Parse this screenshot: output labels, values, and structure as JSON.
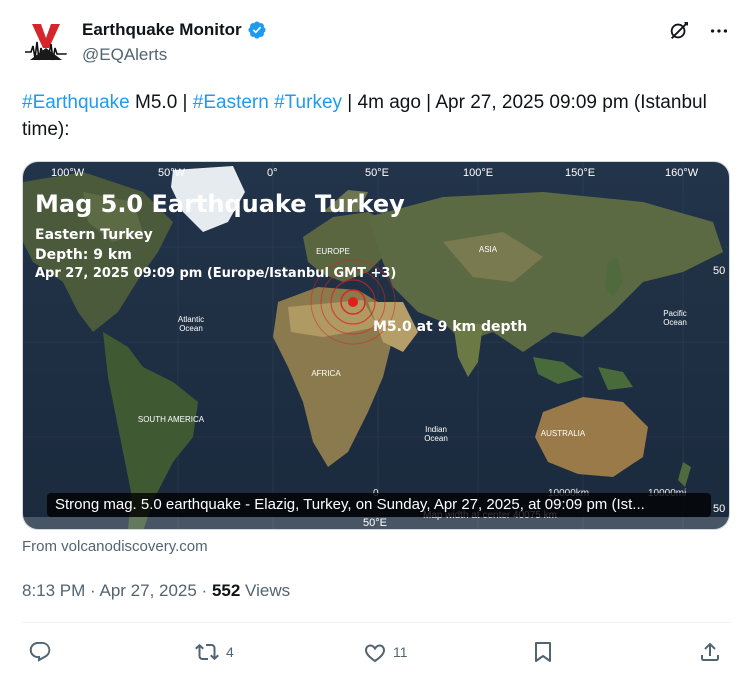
{
  "author": {
    "display_name": "Earthquake Monitor",
    "handle": "@EQAlerts",
    "verified": true,
    "avatar_icon": "earthquake-seismograph-logo-icon"
  },
  "tweet": {
    "tag1": "#Earthquake",
    "text1": " M5.0 | ",
    "tag2": "#Eastern",
    "text2": " ",
    "tag3": "#Turkey",
    "text3": " | 4m ago | Apr 27, 2025 09:09 pm (Istanbul time):"
  },
  "media": {
    "title": "Mag 5.0 Earthquake Turkey",
    "region": "Eastern Turkey",
    "depth": "Depth: 9 km",
    "datetime": "Apr 27, 2025 09:09 pm (Europe/Istanbul GMT +3)",
    "marker_label": "M5.0 at 9 km depth",
    "caption": "Strong mag. 5.0 earthquake - Elazig, Turkey, on Sunday, Apr 27, 2025, at 09:09 pm (Ist...",
    "longitudes": [
      "100°W",
      "50°W",
      "0°",
      "50°E",
      "100°E",
      "150°E",
      "160°W"
    ],
    "latitudes": [
      "50",
      "50",
      "50°E"
    ],
    "regions": {
      "europe": "EUROPE",
      "asia": "ASIA",
      "africa": "AFRICA",
      "south_america": "SOUTH AMERICA",
      "australia": "AUSTRALIA",
      "atlantic": "Atlantic\nOcean",
      "atlantic_l1": "Atlantic",
      "atlantic_l2": "Ocean",
      "pacific_l1": "Pacific",
      "pacific_l2": "Ocean",
      "indian_l1": "Indian",
      "indian_l2": "Ocean"
    },
    "scale_zero": "0",
    "scale_km": "10000km",
    "scale_mi": "10000mi",
    "scale_note": "Map width at center 40075 km"
  },
  "source": "From volcanodiscovery.com",
  "meta": {
    "time": "8:13 PM · Apr 27, 2025 · ",
    "views_count": "552",
    "views_label": " Views"
  },
  "actions": {
    "replies": "",
    "reposts": "4",
    "likes": "11"
  },
  "colors": {
    "link": "#1d9bf0",
    "verified": "#1d9bf0",
    "secondary_text": "#536471",
    "epicenter": "#e0201a"
  }
}
